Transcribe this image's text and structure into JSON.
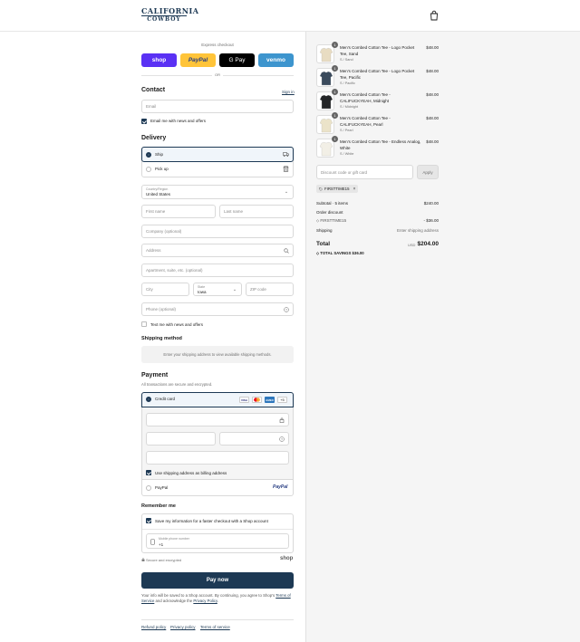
{
  "header": {
    "logo_top": "CALIFORNIA",
    "logo_bottom": "COWBOY",
    "logo_icon": "shopping-bag-icon"
  },
  "express": {
    "title": "Express checkout",
    "or": "OR",
    "buttons": [
      {
        "label": "shop",
        "color": "#5a31f4",
        "text_color": "#ffffff"
      },
      {
        "label": "PayPal",
        "color": "#ffc439",
        "text_color": "#253b80"
      },
      {
        "label": "G Pay",
        "color": "#000000",
        "text_color": "#ffffff"
      },
      {
        "label": "venmo",
        "color": "#3d95ce",
        "text_color": "#ffffff"
      }
    ]
  },
  "contact": {
    "title": "Contact",
    "sign_in": "Sign in",
    "email_placeholder": "Email",
    "email_news_label": "Email me with news and offers",
    "email_news_checked": true
  },
  "delivery": {
    "title": "Delivery",
    "options": [
      {
        "label": "Ship",
        "selected": true,
        "icon": "truck-icon"
      },
      {
        "label": "Pick up",
        "selected": false,
        "icon": "store-icon"
      }
    ],
    "country_label": "Country/Region",
    "country_value": "United States",
    "first_name_placeholder": "First name",
    "last_name_placeholder": "Last name",
    "company_placeholder": "Company (optional)",
    "address_placeholder": "Address",
    "apartment_placeholder": "Apartment, suite, etc. (optional)",
    "city_placeholder": "City",
    "state_label": "State",
    "state_value": "Iowa",
    "zip_placeholder": "ZIP code",
    "phone_placeholder": "Phone (optional)",
    "text_news_label": "Text me with news and offers",
    "text_news_checked": false
  },
  "shipping_method": {
    "title": "Shipping method",
    "notice": "Enter your shipping address to view available shipping methods."
  },
  "payment": {
    "title": "Payment",
    "subtitle": "All transactions are secure and encrypted.",
    "credit_card_label": "Credit card",
    "card_more": "+5",
    "cards": [
      {
        "label": "VISA",
        "color": "#ffffff",
        "text_color": "#1a1f71"
      },
      {
        "label": "MC",
        "color": "#ffffff",
        "text_color": "#eb001b"
      },
      {
        "label": "AMEX",
        "color": "#2e77bc",
        "text_color": "#ffffff"
      }
    ],
    "billing_label": "Use shipping address as billing address",
    "billing_checked": true,
    "paypal_label": "PayPal",
    "paypal_logo": "PayPal"
  },
  "remember": {
    "title": "Remember me",
    "save_label": "Save my information for a faster checkout with a Shop account",
    "save_checked": true,
    "phone_label": "Mobile phone number",
    "phone_value": "+1",
    "secure_label": "Secure and encrypted",
    "shop_label": "shop"
  },
  "pay_now": "Pay now",
  "legal": {
    "text_before": "Your info will be saved to a Shop account. By continuing, you agree to Shop's",
    "terms": "Terms of Service",
    "middle": "and acknowledge the",
    "privacy": "Privacy Policy",
    "end": "."
  },
  "footer": [
    "Refund policy",
    "Privacy policy",
    "Terms of service"
  ],
  "order": {
    "items": [
      {
        "name": "Men's Combed Cotton Tee - Logo Pocket Tee, Sand",
        "variant": "S / Sand",
        "price": "$48.00",
        "qty": "1",
        "shirt_color": "#e8dcc2"
      },
      {
        "name": "Men's Combed Cotton Tee - Logo Pocket Tee, Pacific",
        "variant": "S / Pacific",
        "price": "$48.00",
        "qty": "1",
        "shirt_color": "#3a4a5c"
      },
      {
        "name": "Men's Combed Cotton Tee - CALIFUCKYEAH, Midnight",
        "variant": "S / Midnight",
        "price": "$48.00",
        "qty": "1",
        "shirt_color": "#232527"
      },
      {
        "name": "Men's Combed Cotton Tee - CALIFUCKYEAH, Pearl",
        "variant": "S / Pearl",
        "price": "$48.00",
        "qty": "1",
        "shirt_color": "#ebe3c9"
      },
      {
        "name": "Men's Combed Cotton Tee - Endless Analog, White",
        "variant": "S / White",
        "price": "$48.00",
        "qty": "1",
        "shirt_color": "#f2efe6"
      }
    ],
    "discount_placeholder": "Discount code or gift card",
    "apply": "Apply",
    "code_tag": "FIRSTTIME15",
    "subtotal_label": "Subtotal · 5 items",
    "subtotal_value": "$240.00",
    "order_discount_label": "Order discount",
    "discount_code": "FIRSTTIME15",
    "discount_value": "- $36.00",
    "shipping_label": "Shipping",
    "shipping_value": "Enter shipping address",
    "total_label": "Total",
    "currency": "USD",
    "total_value": "$204.00",
    "savings_label": "TOTAL SAVINGS",
    "savings_value": "$36.00"
  }
}
